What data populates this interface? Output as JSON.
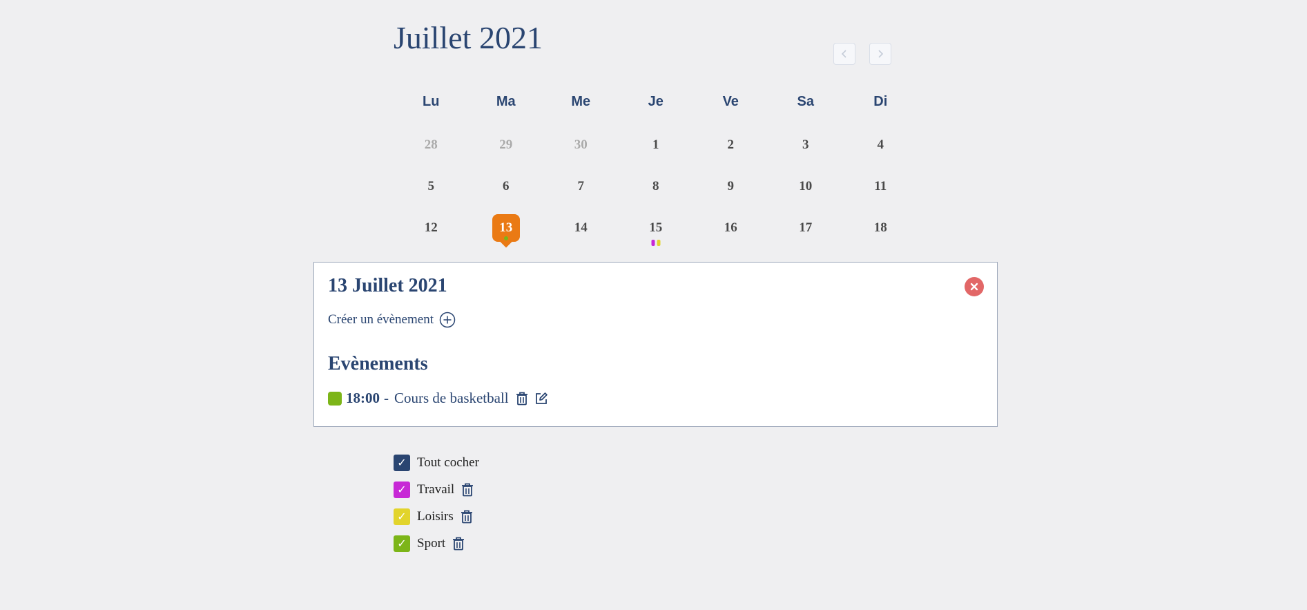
{
  "calendar": {
    "month_title": "Juillet 2021",
    "weekdays": [
      "Lu",
      "Ma",
      "Me",
      "Je",
      "Ve",
      "Sa",
      "Di"
    ],
    "weeks": [
      [
        "28",
        "29",
        "30",
        "1",
        "2",
        "3",
        "4"
      ],
      [
        "5",
        "6",
        "7",
        "8",
        "9",
        "10",
        "11"
      ],
      [
        "12",
        "13",
        "14",
        "15",
        "16",
        "17",
        "18"
      ]
    ],
    "selected_day": "13",
    "prev_icon": "chevron-left-icon",
    "next_icon": "chevron-right-icon"
  },
  "colors": {
    "accent": "#ea7a14",
    "navy": "#2a4571",
    "travail": "#c728d6",
    "loisirs": "#e2d42c",
    "sport": "#7cb518",
    "close": "#e26767"
  },
  "day_panel": {
    "title": "13 Juillet 2021",
    "create_label": "Créer un évènement",
    "events_heading": "Evènements",
    "events": [
      {
        "time": "18:00",
        "separator": "-",
        "name": "Cours de basketball",
        "color": "#7cb518"
      }
    ]
  },
  "categories": {
    "items": [
      {
        "label": "Tout cocher",
        "color": "#2a4571",
        "checked": true
      },
      {
        "label": "Travail",
        "color": "#c728d6",
        "checked": true
      },
      {
        "label": "Loisirs",
        "color": "#e2d42c",
        "checked": true
      },
      {
        "label": "Sport",
        "color": "#7cb518",
        "checked": true
      }
    ]
  }
}
